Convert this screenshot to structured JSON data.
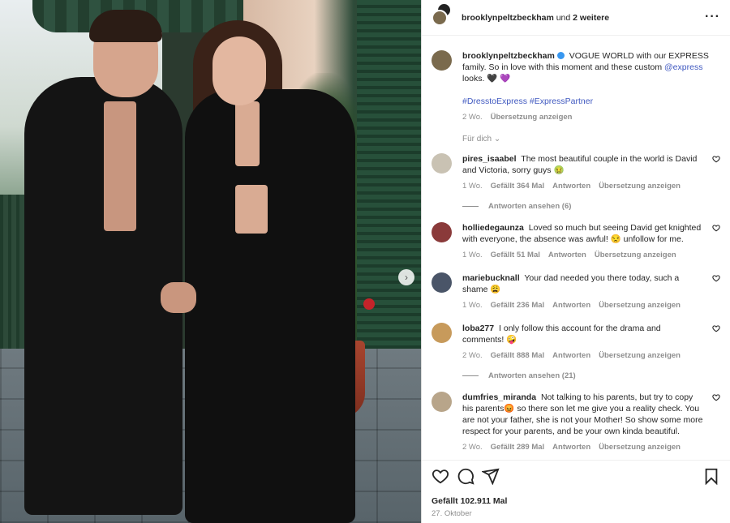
{
  "header": {
    "username": "brooklynpeltzbeckham",
    "and_text": "und",
    "others": "2 weitere",
    "more_icon": "more-horizontal-icon"
  },
  "caption": {
    "username": "brooklynpeltzbeckham",
    "text_part1": "VOGUE WORLD with our EXPRESS family. So in love with this moment and these custom",
    "mention": "@express",
    "text_part2": "looks. 🖤 💜",
    "hashtags": "#DresstoExpress #ExpressPartner",
    "time": "2 Wo.",
    "translate": "Übersetzung anzeigen"
  },
  "sort_label": "Für dich ⌄",
  "comments": [
    {
      "username": "pires_isaabel",
      "text": "The most beautiful couple in the world is David and Victoria, sorry guys 🤢",
      "time": "1 Wo.",
      "likes": "Gefällt 364 Mal",
      "reply": "Antworten",
      "translate": "Übersetzung anzeigen",
      "replies": "Antworten ansehen (6)",
      "avatar_color": "#c9c2b3"
    },
    {
      "username": "holliedegaunza",
      "text": "Loved so much but seeing David get knighted with everyone, the absence was awful! 😒 unfollow for me.",
      "time": "1 Wo.",
      "likes": "Gefällt 51 Mal",
      "reply": "Antworten",
      "translate": "Übersetzung anzeigen",
      "replies": "",
      "avatar_color": "#8a3a3a"
    },
    {
      "username": "mariebucknall",
      "text": "Your dad needed you there today, such a shame 😩",
      "time": "1 Wo.",
      "likes": "Gefällt 236 Mal",
      "reply": "Antworten",
      "translate": "Übersetzung anzeigen",
      "replies": "",
      "avatar_color": "#4a5568"
    },
    {
      "username": "loba277",
      "text": "I only follow this account for the drama and comments! 🤪",
      "time": "2 Wo.",
      "likes": "Gefällt 888 Mal",
      "reply": "Antworten",
      "translate": "Übersetzung anzeigen",
      "replies": "Antworten ansehen (21)",
      "avatar_color": "#c79a5b"
    },
    {
      "username": "dumfries_miranda",
      "text": "Not talking to his parents, but try to copy his parents😡 so there son let me give you a reality check. You are not your father, she is not your Mother! So show some more respect for your parents, and be your own kinda beautiful.",
      "time": "2 Wo.",
      "likes": "Gefällt 289 Mal",
      "reply": "Antworten",
      "translate": "Übersetzung anzeigen",
      "replies": "",
      "avatar_color": "#b8a58a"
    }
  ],
  "footer": {
    "likes": "Gefällt 102.911 Mal",
    "date": "27. Oktober"
  },
  "icons": {
    "like": "heart-icon",
    "comment": "comment-icon",
    "share": "share-icon",
    "save": "bookmark-icon",
    "next": "chevron-right-icon"
  }
}
